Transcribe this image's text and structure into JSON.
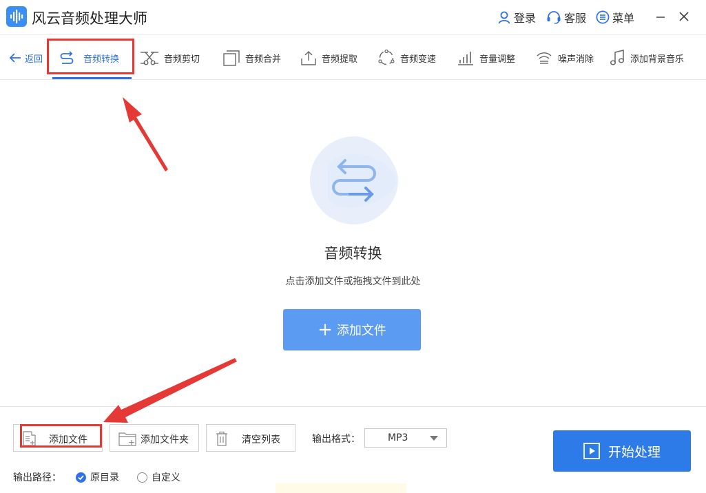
{
  "app": {
    "title": "风云音频处理大师",
    "accent_color": "#2f72e8",
    "logo_icon": "audio-wave-logo"
  },
  "titlebar": {
    "login_label": "登录",
    "login_icon": "user-icon",
    "service_label": "客服",
    "service_icon": "headset-icon",
    "menu_label": "菜单",
    "menu_icon": "menu-icon",
    "minimize_icon": "minimize-icon",
    "close_icon": "close-icon"
  },
  "nav": {
    "back_label": "返回",
    "tabs": [
      {
        "label": "音频转换",
        "icon": "convert-icon",
        "active": true
      },
      {
        "label": "音频剪切",
        "icon": "scissors-icon"
      },
      {
        "label": "音频合并",
        "icon": "merge-icon"
      },
      {
        "label": "音频提取",
        "icon": "extract-icon"
      },
      {
        "label": "音频变速",
        "icon": "speed-icon"
      },
      {
        "label": "音量调整",
        "icon": "volume-bars-icon"
      },
      {
        "label": "噪声消除",
        "icon": "noise-icon"
      },
      {
        "label": "添加背景音乐",
        "icon": "music-note-icon"
      }
    ]
  },
  "dropzone": {
    "title": "音频转换",
    "hint": "点击添加文件或拖拽文件到此处",
    "add_button_label": "添加文件",
    "icon": "convert-arrows-icon"
  },
  "bottom": {
    "add_file_label": "添加文件",
    "add_folder_label": "添加文件夹",
    "clear_list_label": "清空列表",
    "format_label": "输出格式：",
    "format_value": "MP3",
    "start_label": "开始处理",
    "output_path_label": "输出路径：",
    "path_options": [
      {
        "label": "原目录",
        "selected": true
      },
      {
        "label": "自定义",
        "selected": false
      }
    ]
  },
  "annotation_color": "#e53935"
}
